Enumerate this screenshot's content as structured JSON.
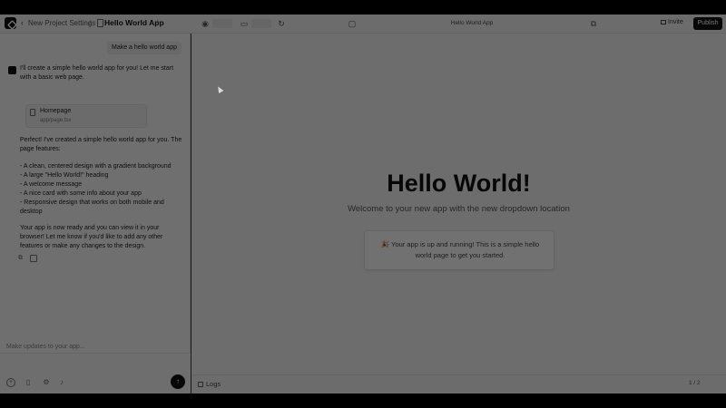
{
  "topbar": {
    "breadcrumb_parent": "New Project Settings",
    "breadcrumb_sep": "/",
    "breadcrumb_current": "Hello World App",
    "url": "Hello World App",
    "invite_label": "Invite",
    "publish_label": "Publish"
  },
  "chat": {
    "user_message": "Make a hello world app",
    "bot_intro": "I'll create a simple hello world app for you! Let me start with a basic web page.",
    "file_card": {
      "title": "Homepage",
      "path": "app/page.tsx"
    },
    "bot_summary": "Perfect! I've created a simple hello world app for you. The page features:",
    "features": [
      "- A clean, centered design with a gradient background",
      "- A large \"Hello World!\" heading",
      "- A welcome message",
      "- A nice card with some info about your app",
      "- Responsive design that works on both mobile and desktop"
    ],
    "bot_closing": "Your app is now ready and you can view it in your browser! Let me know if you'd like to add any other features or make any changes to the design.",
    "composer_placeholder": "Make updates to your app..."
  },
  "preview": {
    "heading": "Hello World!",
    "subheading": "Welcome to your new app with the new dropdown location",
    "card_text": "🎉 Your app is up and running! This is a simple hello world page to get you started."
  },
  "bottombar": {
    "logs_label": "Logs",
    "pager": "1 / 2"
  },
  "icons": [
    "logo-icon",
    "sidebar-toggle-icon",
    "file-icon",
    "star-icon",
    "eye-icon",
    "chat-icon",
    "refresh-icon",
    "new-tab-icon",
    "invite-icon",
    "copy-icon",
    "feedback-icon",
    "add-icon",
    "attach-icon",
    "settings-icon",
    "mic-icon",
    "send-icon",
    "logs-icon"
  ]
}
